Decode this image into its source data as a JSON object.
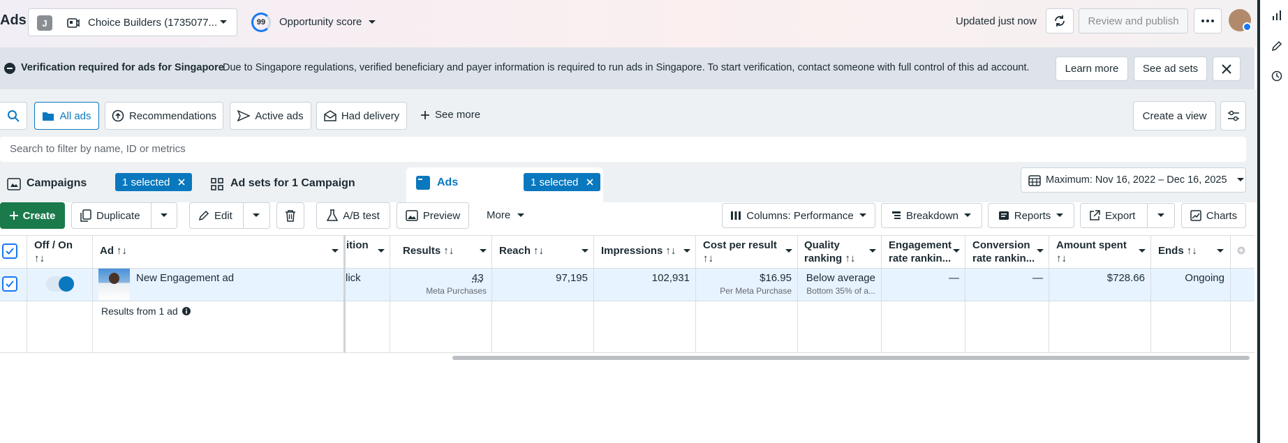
{
  "header": {
    "app_title": "Ads",
    "account_initial": "J",
    "account_name": "Choice Builders (1735077...",
    "score_value": "99",
    "score_label": "Opportunity score",
    "updated_text": "Updated just now",
    "review_publish_label": "Review and publish"
  },
  "banner": {
    "title": "Verification required for ads for Singapore",
    "message": "Due to Singapore regulations, verified beneficiary and payer information is required to run ads in Singapore. To start verification, contact someone with full control of this ad account.",
    "learn_more": "Learn more",
    "see_ad_sets": "See ad sets"
  },
  "filters": {
    "chips": [
      "All ads",
      "Recommendations",
      "Active ads",
      "Had delivery"
    ],
    "see_more": "See more",
    "create_view": "Create a view",
    "search_placeholder": "Search to filter by name, ID or metrics"
  },
  "levels": {
    "campaigns_label": "Campaigns",
    "campaigns_selected": "1 selected",
    "adsets_label": "Ad sets for 1 Campaign",
    "ads_label": "Ads",
    "ads_selected": "1 selected",
    "date_range": "Maximum: Nov 16, 2022 – Dec 16, 2025"
  },
  "toolbar": {
    "create": "Create",
    "duplicate": "Duplicate",
    "edit": "Edit",
    "ab_test": "A/B test",
    "preview": "Preview",
    "more": "More",
    "columns": "Columns: Performance",
    "breakdown": "Breakdown",
    "reports": "Reports",
    "export": "Export",
    "charts": "Charts"
  },
  "table": {
    "headers": {
      "off_on": "Off / On",
      "ad": "Ad",
      "attribution": "ition",
      "results": "Results",
      "reach": "Reach",
      "impressions": "Impressions",
      "cost_per_result": "Cost per result",
      "quality_ranking": "Quality ranking",
      "engagement_ranking": "Engagement rate rankin...",
      "conversion_ranking": "Conversion rate rankin...",
      "amount_spent": "Amount spent",
      "ends": "Ends"
    },
    "row": {
      "ad_name": "New Engagement ad",
      "attribution": "lick",
      "results": "43",
      "results_sub": "Meta Purchases",
      "reach": "97,195",
      "impressions": "102,931",
      "cost_per_result": "$16.95",
      "cost_sub": "Per Meta Purchase",
      "quality_ranking": "Below average",
      "quality_sub": "Bottom 35% of a...",
      "engagement_ranking": "—",
      "conversion_ranking": "—",
      "amount_spent": "$728.66",
      "ends": "Ongoing"
    },
    "summary": "Results from 1 ad"
  },
  "colors": {
    "accent": "#0a78be",
    "create_green": "#1a7a4c",
    "selected_row": "#e7f3ff"
  }
}
